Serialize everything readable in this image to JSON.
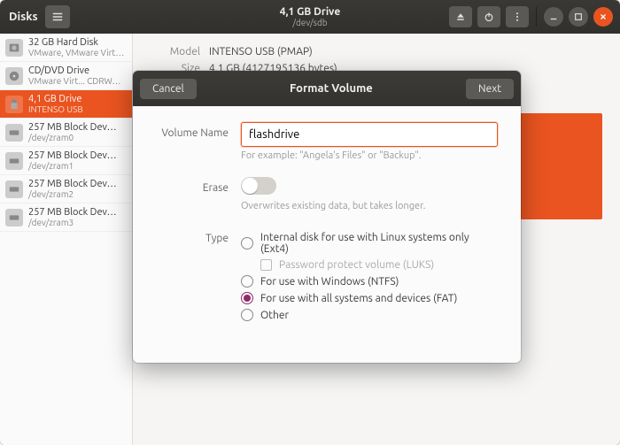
{
  "header": {
    "app_title": "Disks",
    "center_title": "4,1 GB Drive",
    "center_sub": "/dev/sdb"
  },
  "devices": [
    {
      "name": "32 GB Hard Disk",
      "sub": "VMware, VMware Virtual S",
      "sel": false,
      "icon": "hdd"
    },
    {
      "name": "CD/DVD Drive",
      "sub": "VMware Virt... CDRW…",
      "sel": false,
      "icon": "cd"
    },
    {
      "name": "4,1 GB Drive",
      "sub": "INTENSO USB",
      "sel": true,
      "icon": "usb"
    },
    {
      "name": "257 MB Block Dev…",
      "sub": "/dev/zram0",
      "sel": false,
      "icon": "blk"
    },
    {
      "name": "257 MB Block Dev…",
      "sub": "/dev/zram1",
      "sel": false,
      "icon": "blk"
    },
    {
      "name": "257 MB Block Dev…",
      "sub": "/dev/zram2",
      "sel": false,
      "icon": "blk"
    },
    {
      "name": "257 MB Block Dev…",
      "sub": "/dev/zram3",
      "sel": false,
      "icon": "blk"
    }
  ],
  "details": {
    "model_k": "Model",
    "model_v": "INTENSO USB (PMAP)",
    "size_k": "Size",
    "size_v": "4,1 GB (4127195136 bytes)"
  },
  "modal": {
    "title": "Format Volume",
    "cancel": "Cancel",
    "next": "Next",
    "volname_label": "Volume Name",
    "volname_value": "flashdrive",
    "volname_hint": "For example: \"Angela's Files\" or \"Backup\".",
    "erase_label": "Erase",
    "erase_hint": "Overwrites existing data, but takes longer.",
    "type_label": "Type",
    "opt_ext4": "Internal disk for use with Linux systems only (Ext4)",
    "opt_luks": "Password protect volume (LUKS)",
    "opt_ntfs": "For use with Windows (NTFS)",
    "opt_fat": "For use with all systems and devices (FAT)",
    "opt_other": "Other"
  }
}
